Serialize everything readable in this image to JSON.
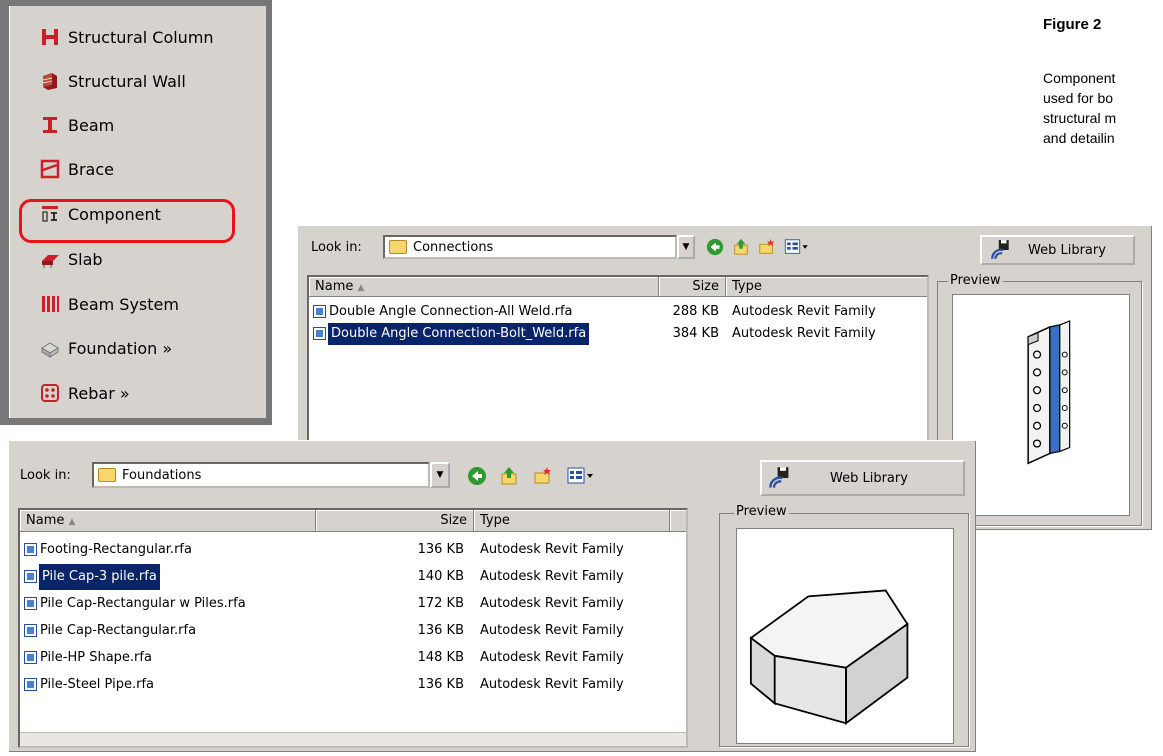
{
  "figure": {
    "title": "Figure 2",
    "caption_lines": [
      "Component",
      "used for bo",
      "structural m",
      "and detailin"
    ]
  },
  "design_bar": {
    "items": [
      {
        "label": "Structural Column",
        "icon": "structural-column-icon"
      },
      {
        "label": "Structural Wall",
        "icon": "structural-wall-icon"
      },
      {
        "label": "Beam",
        "icon": "beam-icon"
      },
      {
        "label": "Brace",
        "icon": "brace-icon"
      },
      {
        "label": "Component",
        "icon": "component-icon"
      },
      {
        "label": "Slab",
        "icon": "slab-icon"
      },
      {
        "label": "Beam System",
        "icon": "beam-system-icon"
      },
      {
        "label": "Foundation »",
        "icon": "foundation-icon"
      },
      {
        "label": "Rebar »",
        "icon": "rebar-icon"
      }
    ],
    "highlight_color": "#e8131b"
  },
  "dialog_back": {
    "look_in_label": "Look in:",
    "look_in_value": "Connections",
    "web_library_label": "Web Library",
    "columns": [
      "Name",
      "Size",
      "Type"
    ],
    "files": [
      {
        "name": "Double Angle Connection-All Weld.rfa",
        "size": "288 KB",
        "type": "Autodesk Revit Family",
        "selected": false
      },
      {
        "name": "Double Angle Connection-Bolt_Weld.rfa",
        "size": "384 KB",
        "type": "Autodesk Revit Family",
        "selected": true
      }
    ],
    "preview_label": "Preview"
  },
  "dialog_front": {
    "look_in_label": "Look in:",
    "look_in_value": "Foundations",
    "web_library_label": "Web Library",
    "columns": [
      "Name",
      "Size",
      "Type"
    ],
    "files": [
      {
        "name": "Footing-Rectangular.rfa",
        "size": "136 KB",
        "type": "Autodesk Revit Family",
        "selected": false
      },
      {
        "name": "Pile Cap-3 pile.rfa",
        "size": "140 KB",
        "type": "Autodesk Revit Family",
        "selected": true
      },
      {
        "name": "Pile Cap-Rectangular w Piles.rfa",
        "size": "172 KB",
        "type": "Autodesk Revit Family",
        "selected": false
      },
      {
        "name": "Pile Cap-Rectangular.rfa",
        "size": "136 KB",
        "type": "Autodesk Revit Family",
        "selected": false
      },
      {
        "name": "Pile-HP Shape.rfa",
        "size": "148 KB",
        "type": "Autodesk Revit Family",
        "selected": false
      },
      {
        "name": "Pile-Steel Pipe.rfa",
        "size": "136 KB",
        "type": "Autodesk Revit Family",
        "selected": false
      }
    ],
    "preview_label": "Preview"
  },
  "colors": {
    "selection": "#0a246a",
    "dialog_face": "#d6d3ce",
    "highlight": "#e8131b"
  }
}
